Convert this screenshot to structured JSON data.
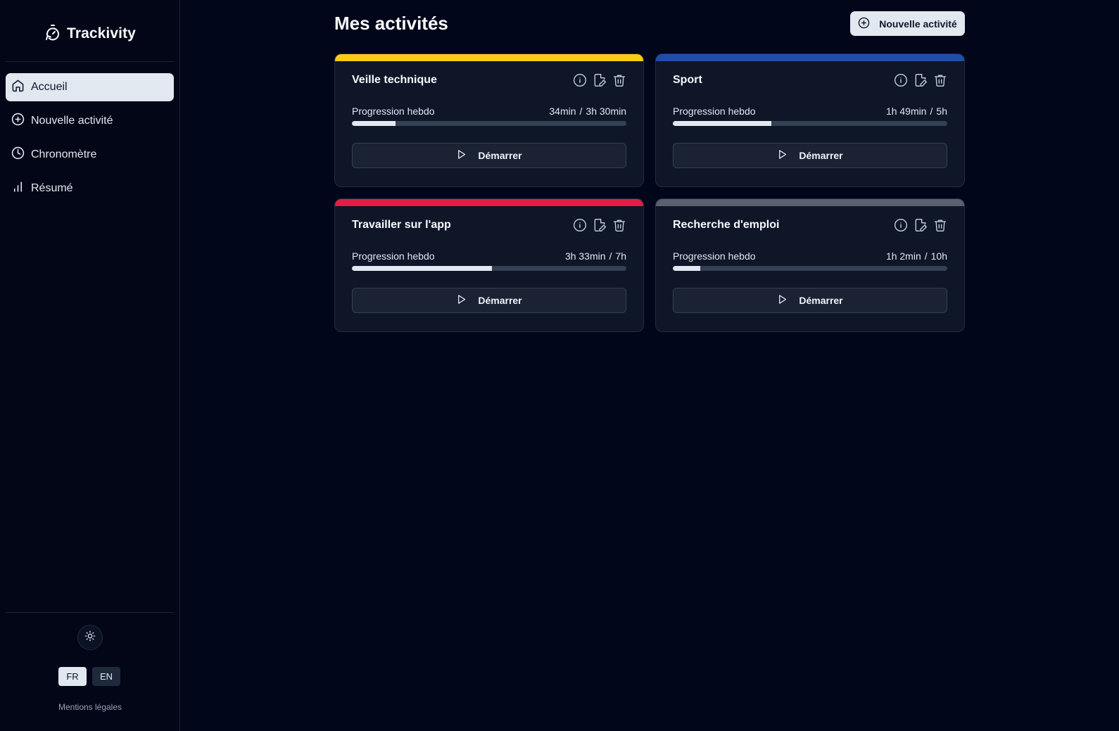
{
  "brand": {
    "name": "Trackivity",
    "icon": "timer-icon"
  },
  "sidebar": {
    "items": [
      {
        "label": "Accueil",
        "icon": "home-icon",
        "active": true
      },
      {
        "label": "Nouvelle activité",
        "icon": "plus-circle-icon",
        "active": false
      },
      {
        "label": "Chronomètre",
        "icon": "clock-icon",
        "active": false
      },
      {
        "label": "Résumé",
        "icon": "bar-chart-icon",
        "active": false
      }
    ],
    "theme_icon": "sun-icon",
    "languages": [
      {
        "code": "FR",
        "active": true
      },
      {
        "code": "EN",
        "active": false
      }
    ],
    "legal": "Mentions légales"
  },
  "main": {
    "title": "Mes activités",
    "new_button": "Nouvelle activité",
    "progress_label": "Progression hebdo",
    "start_label": "Démarrer",
    "activities": [
      {
        "name": "Veille technique",
        "color": "#facc15",
        "done": "34min",
        "goal": "3h 30min",
        "progress": 0.16
      },
      {
        "name": "Sport",
        "color": "#1e4fa8",
        "done": "1h 49min",
        "goal": "5h",
        "progress": 0.36
      },
      {
        "name": "Travailler sur l'app",
        "color": "#e11d48",
        "done": "3h 33min",
        "goal": "7h",
        "progress": 0.51
      },
      {
        "name": "Recherche d'emploi",
        "color": "#5b6070",
        "done": "1h 2min",
        "goal": "10h",
        "progress": 0.1
      }
    ]
  }
}
